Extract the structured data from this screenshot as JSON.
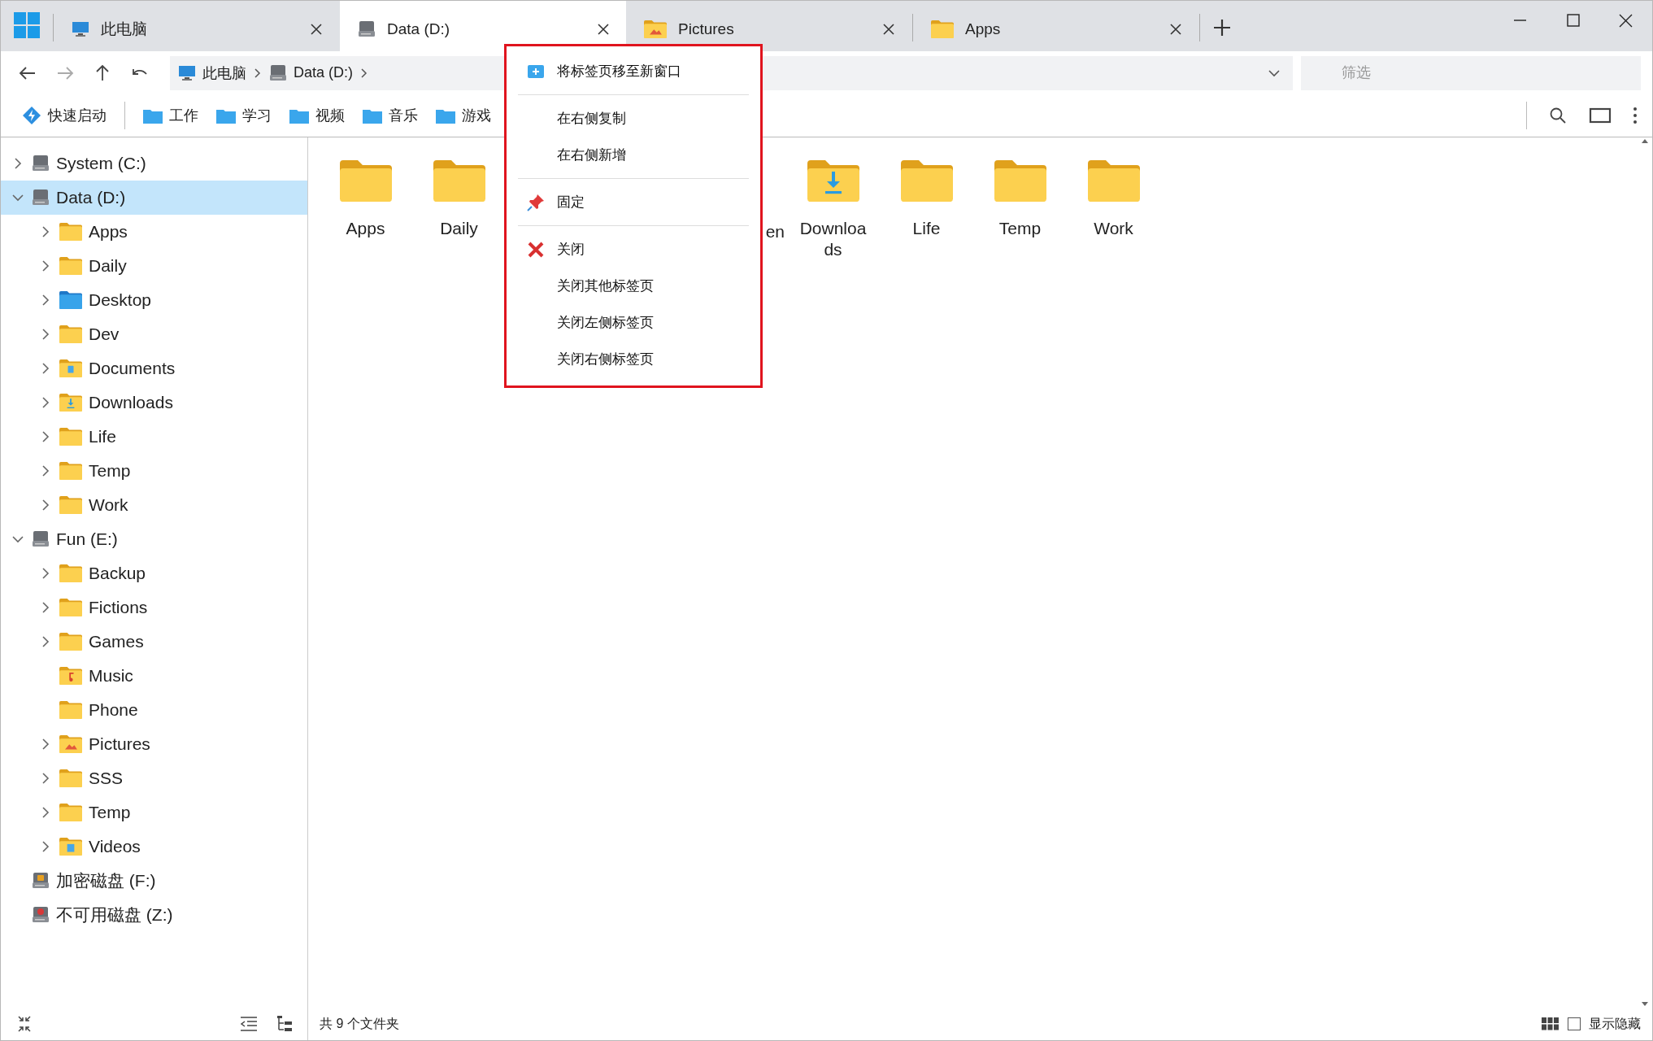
{
  "tabs": [
    {
      "label": "此电脑",
      "kind": "computer",
      "selected": false
    },
    {
      "label": "Data (D:)",
      "kind": "drive",
      "selected": true
    },
    {
      "label": "Pictures",
      "kind": "pictures",
      "selected": false
    },
    {
      "label": "Apps",
      "kind": "folder",
      "selected": false
    }
  ],
  "breadcrumb": [
    {
      "label": "此电脑",
      "kind": "computer"
    },
    {
      "label": "Data (D:)",
      "kind": "drive"
    }
  ],
  "filter": {
    "placeholder": "筛选"
  },
  "quick_bar": [
    {
      "label": "快速启动",
      "kind": "launch"
    },
    {
      "label": "工作",
      "kind": "folder"
    },
    {
      "label": "学习",
      "kind": "folder"
    },
    {
      "label": "视频",
      "kind": "folder"
    },
    {
      "label": "音乐",
      "kind": "folder"
    },
    {
      "label": "游戏",
      "kind": "folder"
    }
  ],
  "tree": [
    {
      "label": "System (C:)",
      "kind": "drive",
      "expandable": true,
      "expanded": false,
      "selected": false
    },
    {
      "label": "Data (D:)",
      "kind": "drive",
      "expandable": true,
      "expanded": true,
      "selected": true,
      "children": [
        {
          "label": "Apps",
          "kind": "folder",
          "expandable": true,
          "expanded": false,
          "selected": false
        },
        {
          "label": "Daily",
          "kind": "folder",
          "expandable": true,
          "expanded": false,
          "selected": false
        },
        {
          "label": "Desktop",
          "kind": "desktop",
          "expandable": true,
          "expanded": false,
          "selected": false
        },
        {
          "label": "Dev",
          "kind": "folder",
          "expandable": true,
          "expanded": false,
          "selected": false
        },
        {
          "label": "Documents",
          "kind": "documents",
          "expandable": true,
          "expanded": false,
          "selected": false
        },
        {
          "label": "Downloads",
          "kind": "downloads",
          "expandable": true,
          "expanded": false,
          "selected": false
        },
        {
          "label": "Life",
          "kind": "folder",
          "expandable": true,
          "expanded": false,
          "selected": false
        },
        {
          "label": "Temp",
          "kind": "folder",
          "expandable": true,
          "expanded": false,
          "selected": false
        },
        {
          "label": "Work",
          "kind": "folder",
          "expandable": true,
          "expanded": false,
          "selected": false
        }
      ]
    },
    {
      "label": "Fun (E:)",
      "kind": "drive",
      "expandable": true,
      "expanded": true,
      "selected": false,
      "children": [
        {
          "label": "Backup",
          "kind": "folder",
          "expandable": true,
          "expanded": false,
          "selected": false
        },
        {
          "label": "Fictions",
          "kind": "folder",
          "expandable": true,
          "expanded": false,
          "selected": false
        },
        {
          "label": "Games",
          "kind": "folder",
          "expandable": true,
          "expanded": false,
          "selected": false
        },
        {
          "label": "Music",
          "kind": "music",
          "selected": false
        },
        {
          "label": "Phone",
          "kind": "folder",
          "selected": false
        },
        {
          "label": "Pictures",
          "kind": "pictures",
          "expandable": true,
          "expanded": false,
          "selected": false
        },
        {
          "label": "SSS",
          "kind": "folder",
          "expandable": true,
          "expanded": false,
          "selected": false
        },
        {
          "label": "Temp",
          "kind": "folder",
          "expandable": true,
          "expanded": false,
          "selected": false
        },
        {
          "label": "Videos",
          "kind": "videos",
          "expandable": true,
          "expanded": false,
          "selected": false
        }
      ]
    },
    {
      "label": "加密磁盘 (F:)",
      "kind": "locked-drive",
      "selected": false
    },
    {
      "label": "不可用磁盘 (Z:)",
      "kind": "offline-drive",
      "selected": false
    }
  ],
  "files": [
    {
      "label": "Apps",
      "kind": "folder"
    },
    {
      "label": "Daily",
      "kind": "folder"
    },
    {
      "label": "en",
      "kind": "partial"
    },
    {
      "label": "Downloa\nds",
      "kind": "downloads"
    },
    {
      "label": "Life",
      "kind": "folder"
    },
    {
      "label": "Temp",
      "kind": "folder"
    },
    {
      "label": "Work",
      "kind": "folder"
    }
  ],
  "context_menu": [
    {
      "kind": "new-window",
      "label": "将标签页移至新窗口"
    },
    {
      "kind": "divider"
    },
    {
      "kind": "item",
      "label": "在右侧复制"
    },
    {
      "kind": "item",
      "label": "在右侧新增"
    },
    {
      "kind": "divider"
    },
    {
      "kind": "pin",
      "label": "固定"
    },
    {
      "kind": "divider"
    },
    {
      "kind": "close",
      "label": "关闭"
    },
    {
      "kind": "item",
      "label": "关闭其他标签页"
    },
    {
      "kind": "item",
      "label": "关闭左侧标签页"
    },
    {
      "kind": "item",
      "label": "关闭右侧标签页"
    }
  ],
  "status": {
    "summary": "共 9 个文件夹",
    "show_hidden": {
      "label": "显示隐藏",
      "checked": false
    }
  }
}
